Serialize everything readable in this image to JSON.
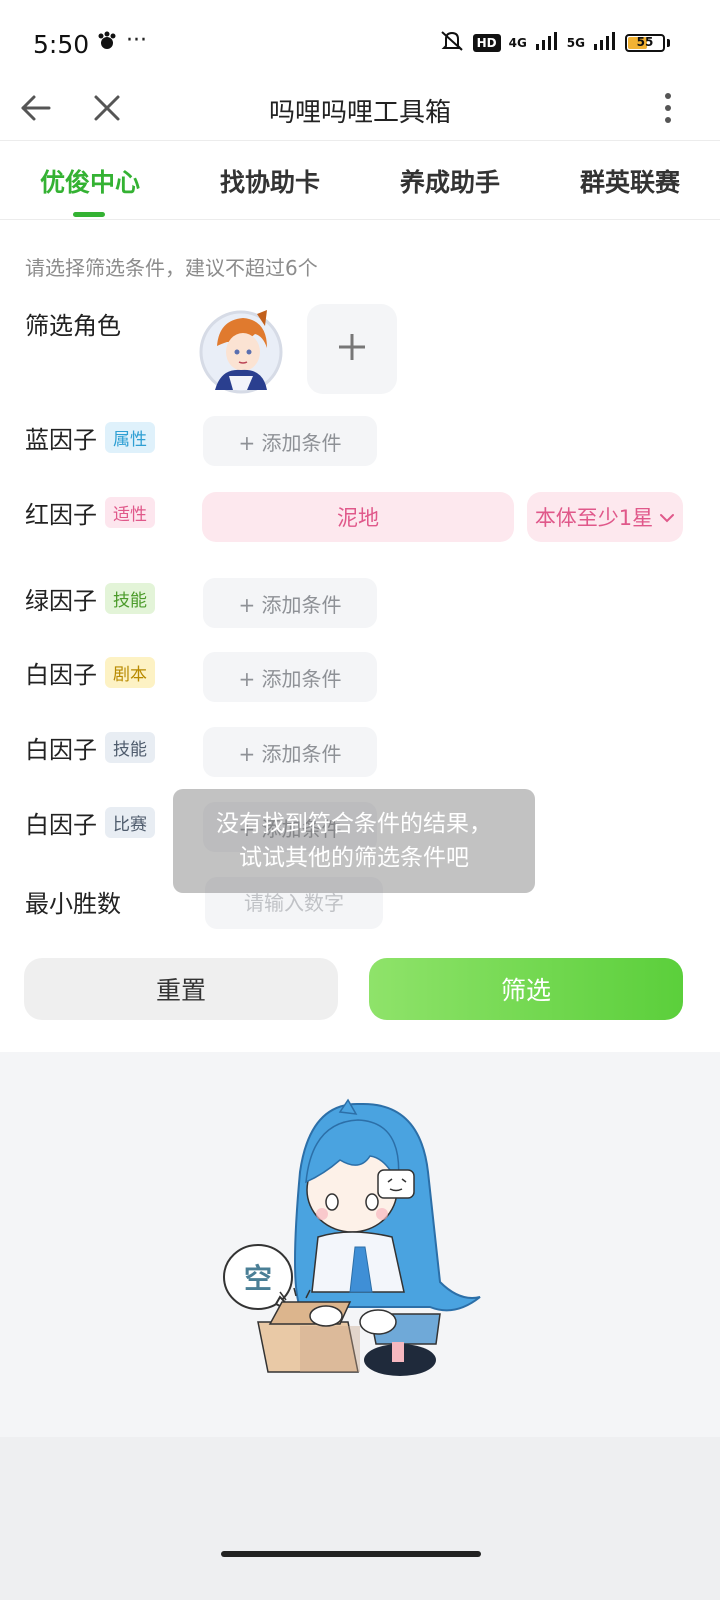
{
  "status_bar": {
    "time": "5:50",
    "more": "···",
    "hd": "HD",
    "net1": "4G",
    "net2": "5G",
    "battery": "55",
    "battery_level": 0.55
  },
  "header": {
    "title": "吗哩吗哩工具箱",
    "back_icon": "arrow-left-icon",
    "close_icon": "close-icon",
    "menu_icon": "more-vertical-icon"
  },
  "tabs": [
    {
      "label": "优俊中心",
      "active": true
    },
    {
      "label": "找协助卡",
      "active": false
    },
    {
      "label": "养成助手",
      "active": false
    },
    {
      "label": "群英联赛",
      "active": false
    }
  ],
  "hint": "请选择筛选条件，建议不超过6个",
  "rows": {
    "character": {
      "label": "筛选角色"
    },
    "blue": {
      "label": "蓝因子",
      "tag": "属性",
      "action": "+ 添加条件"
    },
    "red": {
      "label": "红因子",
      "tag": "适性",
      "value": "泥地",
      "select": "本体至少1星"
    },
    "green": {
      "label": "绿因子",
      "tag": "技能",
      "action": "+ 添加条件"
    },
    "white_script": {
      "label": "白因子",
      "tag": "剧本",
      "action": "+ 添加条件"
    },
    "white_skill": {
      "label": "白因子",
      "tag": "技能",
      "action": "+ 添加条件"
    },
    "white_race": {
      "label": "白因子",
      "tag": "比赛",
      "action": "+ 添加条件"
    },
    "min_wins": {
      "label": "最小胜数",
      "placeholder": "请输入数字"
    }
  },
  "buttons": {
    "reset": "重置",
    "filter": "筛选"
  },
  "toast": {
    "line1": "没有找到符合条件的结果，",
    "line2": "试试其他的筛选条件吧"
  },
  "empty": {
    "bubble": "空"
  },
  "colors": {
    "accent": "#34b233",
    "filter_button": "#5bcf3b",
    "pink": "#e0588a"
  }
}
